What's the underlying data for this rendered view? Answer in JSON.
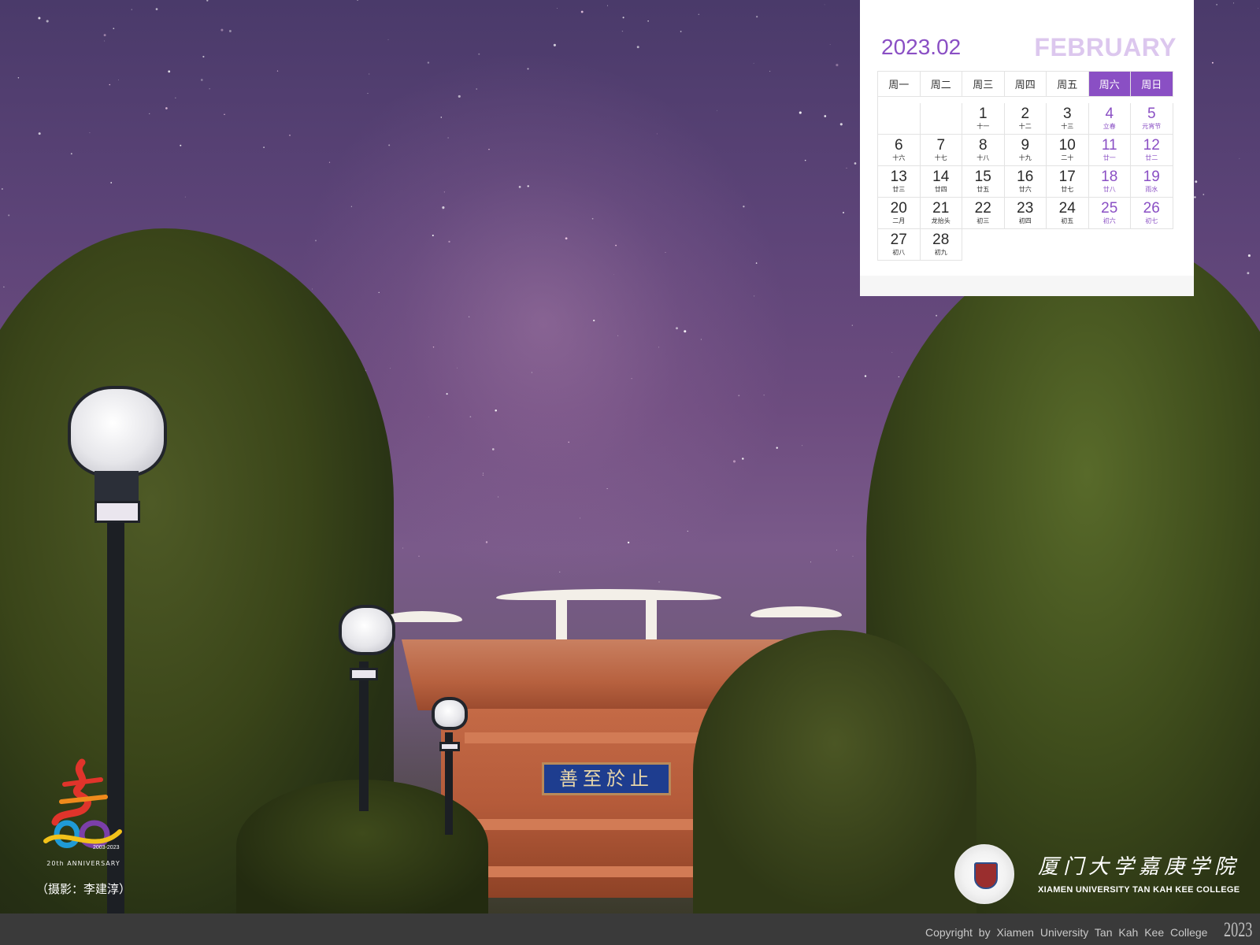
{
  "calendar": {
    "year_month": "2023.02",
    "month_name": "FEBRUARY",
    "weekdays": [
      "周一",
      "周二",
      "周三",
      "周四",
      "周五",
      "周六",
      "周日"
    ],
    "weeks": [
      [
        null,
        null,
        {
          "day": "1",
          "lunar": "十一"
        },
        {
          "day": "2",
          "lunar": "十二"
        },
        {
          "day": "3",
          "lunar": "十三"
        },
        {
          "day": "4",
          "lunar": "立春"
        },
        {
          "day": "5",
          "lunar": "元宵节"
        }
      ],
      [
        {
          "day": "6",
          "lunar": "十六"
        },
        {
          "day": "7",
          "lunar": "十七"
        },
        {
          "day": "8",
          "lunar": "十八"
        },
        {
          "day": "9",
          "lunar": "十九"
        },
        {
          "day": "10",
          "lunar": "二十"
        },
        {
          "day": "11",
          "lunar": "廿一"
        },
        {
          "day": "12",
          "lunar": "廿二"
        }
      ],
      [
        {
          "day": "13",
          "lunar": "廿三"
        },
        {
          "day": "14",
          "lunar": "廿四"
        },
        {
          "day": "15",
          "lunar": "廿五"
        },
        {
          "day": "16",
          "lunar": "廿六"
        },
        {
          "day": "17",
          "lunar": "廿七"
        },
        {
          "day": "18",
          "lunar": "廿八"
        },
        {
          "day": "19",
          "lunar": "雨水"
        }
      ],
      [
        {
          "day": "20",
          "lunar": "二月"
        },
        {
          "day": "21",
          "lunar": "龙抬头"
        },
        {
          "day": "22",
          "lunar": "初三"
        },
        {
          "day": "23",
          "lunar": "初四"
        },
        {
          "day": "24",
          "lunar": "初五"
        },
        {
          "day": "25",
          "lunar": "初六"
        },
        {
          "day": "26",
          "lunar": "初七"
        }
      ],
      [
        {
          "day": "27",
          "lunar": "初八"
        },
        {
          "day": "28",
          "lunar": "初九"
        },
        null,
        null,
        null,
        null,
        null
      ]
    ]
  },
  "photo": {
    "plaque_text": "善至於止",
    "credit": "（摄影：李建淳）"
  },
  "anniversary": {
    "years": "2003-2023",
    "label": "20th ANNIVERSARY"
  },
  "college": {
    "name_cn": "厦门大学嘉庚学院",
    "name_en": "XIAMEN UNIVERSITY TAN KAH KEE COLLEGE"
  },
  "footer": {
    "copyright": "Copyright by Xiamen University Tan Kah Kee College",
    "year": "2023"
  },
  "colors": {
    "accent": "#8a4fc4",
    "month_name": "#dcc7ee",
    "footer_bg": "#3a3a3a"
  }
}
